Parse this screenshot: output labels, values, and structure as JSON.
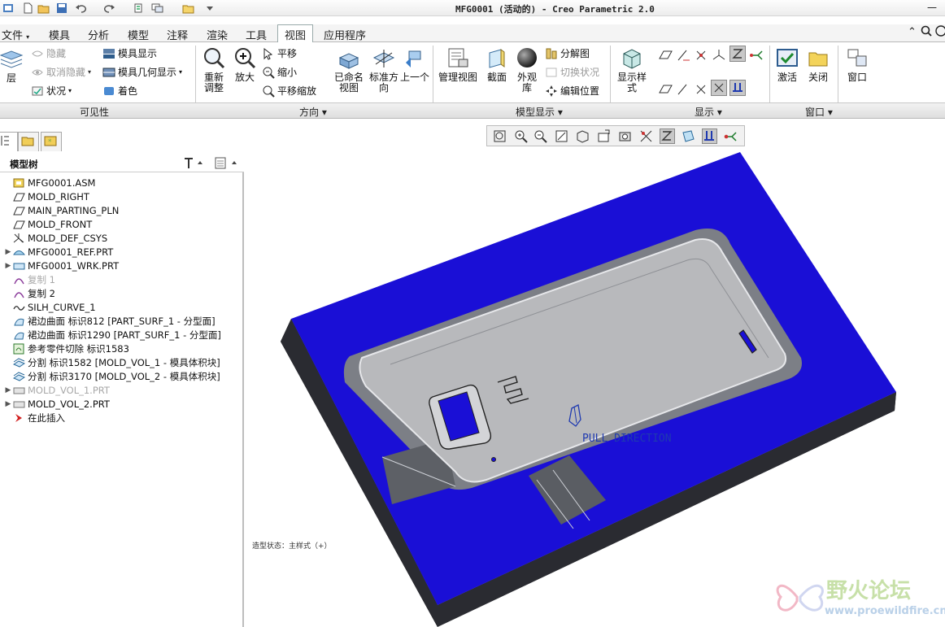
{
  "window": {
    "title": "MFG0001 (活动的) - Creo Parametric 2.0"
  },
  "menu": {
    "tabs": [
      "文件",
      "模具",
      "分析",
      "模型",
      "注释",
      "渲染",
      "工具",
      "视图",
      "应用程序"
    ],
    "active": "视图"
  },
  "ribbon": {
    "layers": {
      "label": "层"
    },
    "visibility": {
      "hide": "隐藏",
      "unhide": "取消隐藏",
      "status": "状况",
      "mold_display": "模具显示",
      "mold_geometry_display": "模具几何显示",
      "color": "着色"
    },
    "orientation": {
      "refit": "重新调整",
      "zoom_in": "放大",
      "pan": "平移",
      "zoom_out": "缩小",
      "pan_zoom": "平移缩放",
      "saved_views": "已命名视图",
      "standard_orientation": "标准方向",
      "previous": "上一个"
    },
    "model_display": {
      "manage_views": "管理视图",
      "section": "截面",
      "appearance": "外观库",
      "exploded_view": "分解图",
      "toggle_status": "切换状况",
      "edit_position": "编辑位置"
    },
    "display": {
      "display_style": "显示样式"
    },
    "window": {
      "activate": "激活",
      "close": "关闭",
      "windows": "窗口"
    },
    "groups": [
      "可见性",
      "方向",
      "模型显示",
      "显示",
      "窗口"
    ]
  },
  "model_tree": {
    "title": "模型树",
    "items": [
      {
        "label": "MFG0001.ASM",
        "icon": "assembly-icon",
        "expander": "",
        "dim": false
      },
      {
        "label": "MOLD_RIGHT",
        "icon": "datum-plane-icon",
        "expander": "",
        "dim": false
      },
      {
        "label": "MAIN_PARTING_PLN",
        "icon": "datum-plane-icon",
        "expander": "",
        "dim": false
      },
      {
        "label": "MOLD_FRONT",
        "icon": "datum-plane-icon",
        "expander": "",
        "dim": false
      },
      {
        "label": "MOLD_DEF_CSYS",
        "icon": "csys-icon",
        "expander": "",
        "dim": false
      },
      {
        "label": "MFG0001_REF.PRT",
        "icon": "reference-part-icon",
        "expander": "▶",
        "dim": false
      },
      {
        "label": "MFG0001_WRK.PRT",
        "icon": "workpiece-icon",
        "expander": "▶",
        "dim": false
      },
      {
        "label": "复制 1",
        "icon": "copy-surface-icon",
        "expander": "",
        "dim": true
      },
      {
        "label": "复制 2",
        "icon": "copy-surface-icon",
        "expander": "",
        "dim": false
      },
      {
        "label": "SILH_CURVE_1",
        "icon": "curve-icon",
        "expander": "",
        "dim": false
      },
      {
        "label": "裙边曲面 标识812 [PART_SURF_1 - 分型面]",
        "icon": "skirt-surface-icon",
        "expander": "",
        "dim": false
      },
      {
        "label": "裙边曲面 标识1290 [PART_SURF_1 - 分型面]",
        "icon": "skirt-surface-icon",
        "expander": "",
        "dim": false
      },
      {
        "label": "参考零件切除 标识1583",
        "icon": "cutout-icon",
        "expander": "",
        "dim": false
      },
      {
        "label": "分割 标识1582 [MOLD_VOL_1 - 模具体积块]",
        "icon": "split-icon",
        "expander": "",
        "dim": false
      },
      {
        "label": "分割 标识3170 [MOLD_VOL_2 - 模具体积块]",
        "icon": "split-icon",
        "expander": "",
        "dim": false
      },
      {
        "label": "MOLD_VOL_1.PRT",
        "icon": "mold-volume-part-icon",
        "expander": "▶",
        "dim": true
      },
      {
        "label": "MOLD_VOL_2.PRT",
        "icon": "mold-volume-part-icon",
        "expander": "▶",
        "dim": false
      },
      {
        "label": "在此插入",
        "icon": "insert-here-icon",
        "expander": "",
        "dim": false
      }
    ]
  },
  "viewport": {
    "pull_direction_label": "PULL DIRECTION",
    "status": "造型状态：主样式（+）"
  },
  "watermark": {
    "name": "野火论坛",
    "url": "www.proewildfire.cn"
  },
  "colors": {
    "mold_blue": "#1a0fd6",
    "mold_side": "#2c2d33",
    "part_gray": "#b7b8bb",
    "pull_arrow": "#1f3ab0"
  }
}
